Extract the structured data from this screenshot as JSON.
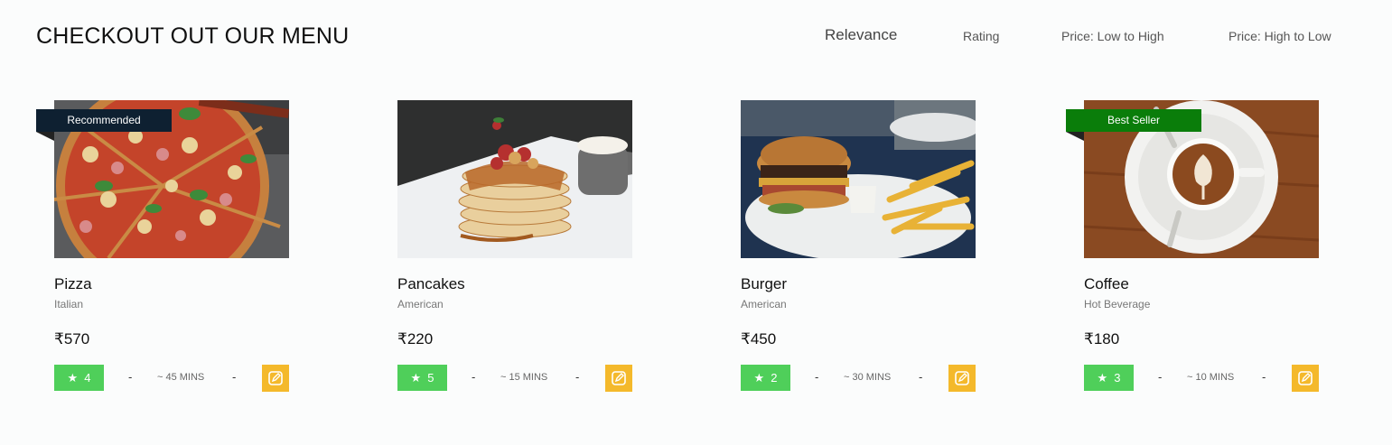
{
  "header": {
    "title": "CHECKOUT OUT OUR MENU",
    "sort_options": [
      "Relevance",
      "Rating",
      "Price: Low to High",
      "Price: High to Low"
    ],
    "active_sort": "Relevance"
  },
  "colors": {
    "background": "#fbfcfc",
    "rating_badge": "#4fcf5a",
    "edit_button": "#f4b92b",
    "recommended_ribbon": "#0e2031",
    "best_seller_ribbon": "#0a7d0a"
  },
  "items": [
    {
      "name": "Pizza",
      "cuisine": "Italian",
      "price": "₹570",
      "rating": "4",
      "eta": "~ 45 MINS",
      "ribbon": "Recommended",
      "image": "pizza-photo",
      "star_icon": "★",
      "dash": "-"
    },
    {
      "name": "Pancakes",
      "cuisine": "American",
      "price": "₹220",
      "rating": "5",
      "eta": "~ 15 MINS",
      "ribbon": "",
      "image": "pancakes-photo",
      "star_icon": "★",
      "dash": "-"
    },
    {
      "name": "Burger",
      "cuisine": "American",
      "price": "₹450",
      "rating": "2",
      "eta": "~ 30 MINS",
      "ribbon": "",
      "image": "burger-photo",
      "star_icon": "★",
      "dash": "-"
    },
    {
      "name": "Coffee",
      "cuisine": "Hot Beverage",
      "price": "₹180",
      "rating": "3",
      "eta": "~ 10 MINS",
      "ribbon": "Best Seller",
      "image": "coffee-photo",
      "star_icon": "★",
      "dash": "-"
    }
  ]
}
